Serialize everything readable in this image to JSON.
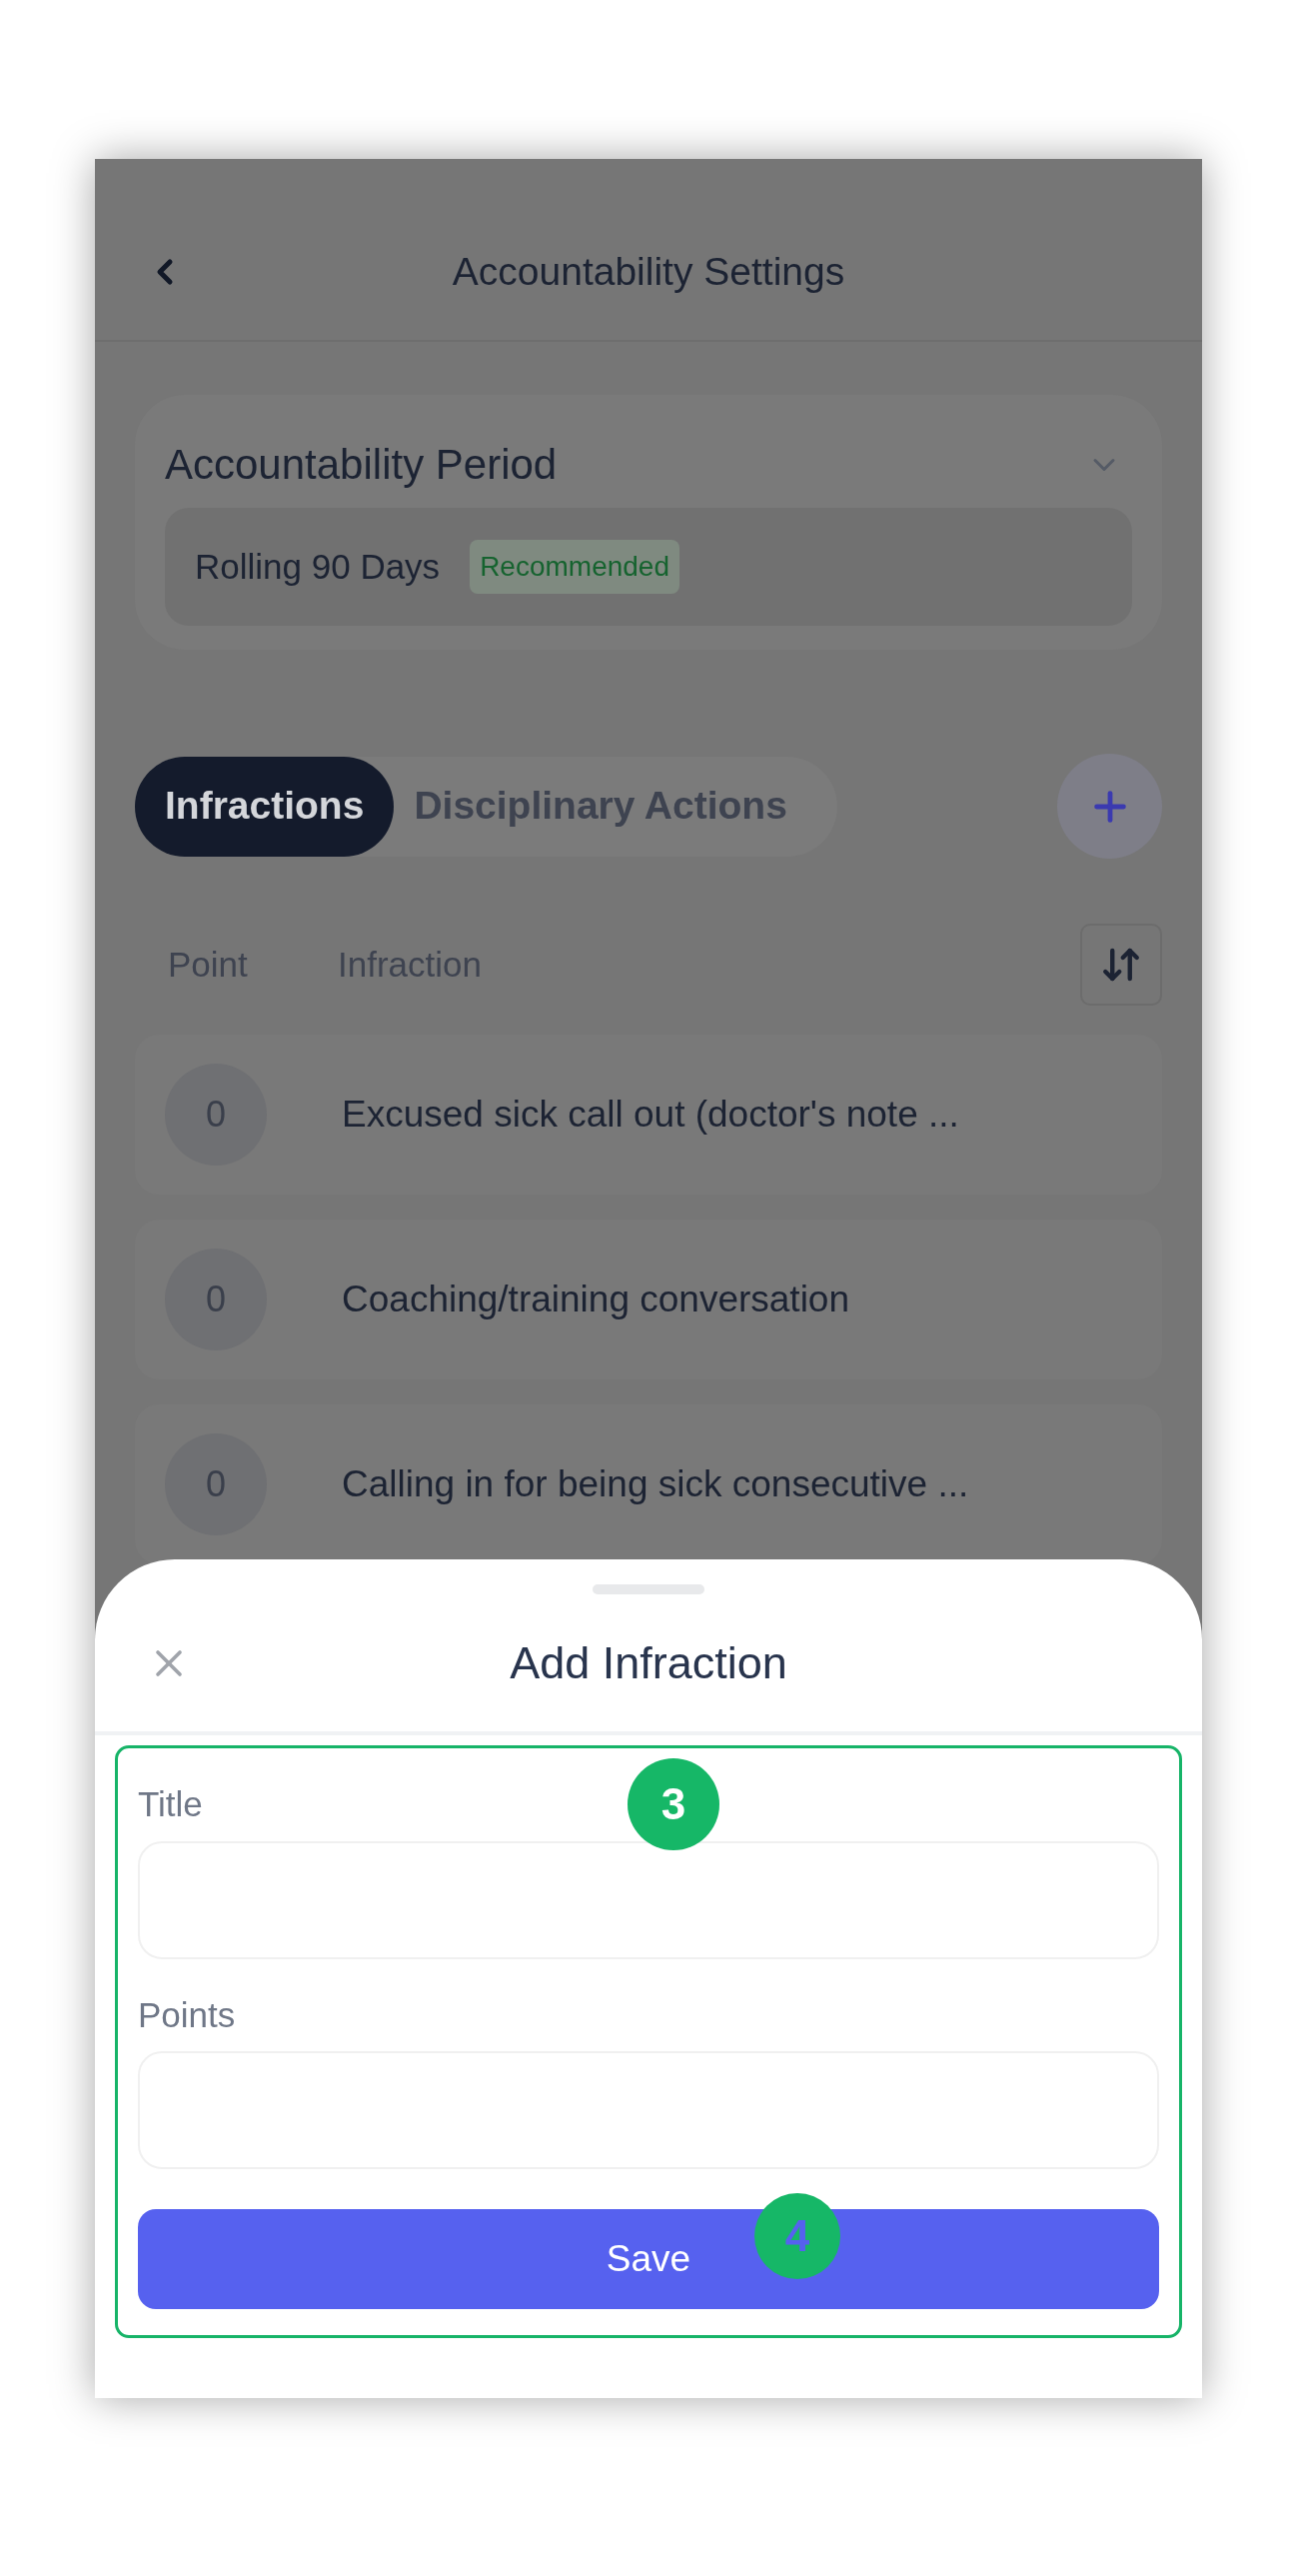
{
  "header": {
    "title": "Accountability Settings"
  },
  "period": {
    "label": "Accountability Period",
    "value": "Rolling 90 Days",
    "badge": "Recommended"
  },
  "tabs": [
    {
      "label": "Infractions",
      "selected": true
    },
    {
      "label": "Disciplinary Actions",
      "selected": false
    }
  ],
  "columns": [
    "Point",
    "Infraction"
  ],
  "rows": [
    {
      "points": "0",
      "infraction": "Excused sick call out (doctor's note ..."
    },
    {
      "points": "0",
      "infraction": "Coaching/training conversation"
    },
    {
      "points": "0",
      "infraction": "Calling in for being sick consecutive ..."
    }
  ],
  "sheet": {
    "title": "Add Infraction",
    "fields": [
      {
        "label": "Title"
      },
      {
        "label": "Points"
      }
    ],
    "save": "Save"
  },
  "annotations": [
    "3",
    "4"
  ]
}
